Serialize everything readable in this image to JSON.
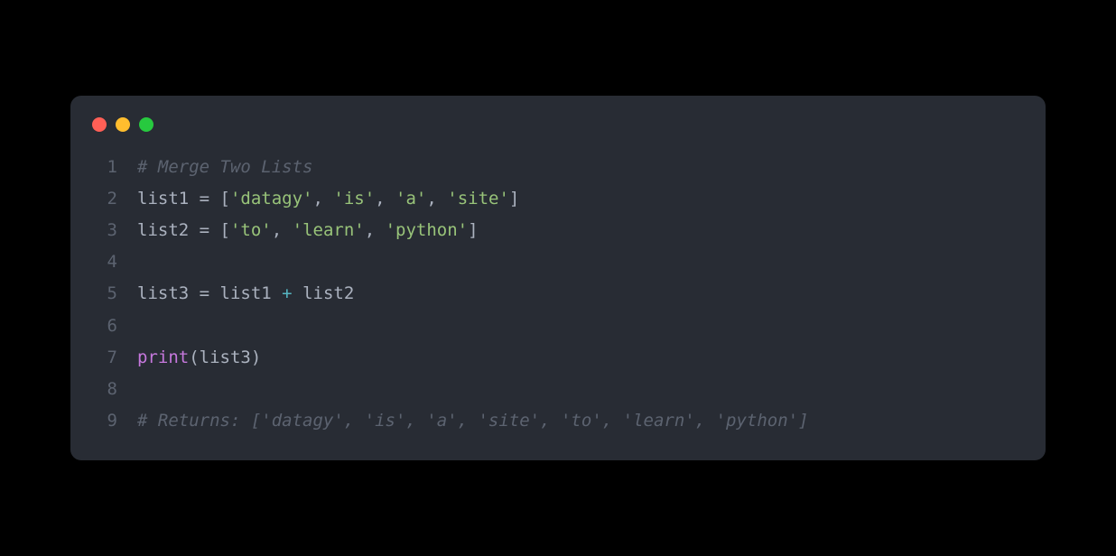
{
  "traffic_lights": {
    "red": "#ff5f56",
    "yellow": "#ffbd2e",
    "green": "#27c93f"
  },
  "line_numbers": [
    "1",
    "2",
    "3",
    "4",
    "5",
    "6",
    "7",
    "8",
    "9"
  ],
  "code": {
    "line1": {
      "comment": "# Merge Two Lists"
    },
    "line2": {
      "var": "list1",
      "eq": " = ",
      "lb": "[",
      "s1": "'datagy'",
      "c1": ", ",
      "s2": "'is'",
      "c2": ", ",
      "s3": "'a'",
      "c3": ", ",
      "s4": "'site'",
      "rb": "]"
    },
    "line3": {
      "var": "list2",
      "eq": " = ",
      "lb": "[",
      "s1": "'to'",
      "c1": ", ",
      "s2": "'learn'",
      "c2": ", ",
      "s3": "'python'",
      "rb": "]"
    },
    "line5": {
      "var": "list3",
      "eq": " = ",
      "v1": "list1",
      "plus": " + ",
      "v2": "list2"
    },
    "line7": {
      "fn": "print",
      "lp": "(",
      "arg": "list3",
      "rp": ")"
    },
    "line9": {
      "comment": "# Returns: ['datagy', 'is', 'a', 'site', 'to', 'learn', 'python']"
    }
  }
}
